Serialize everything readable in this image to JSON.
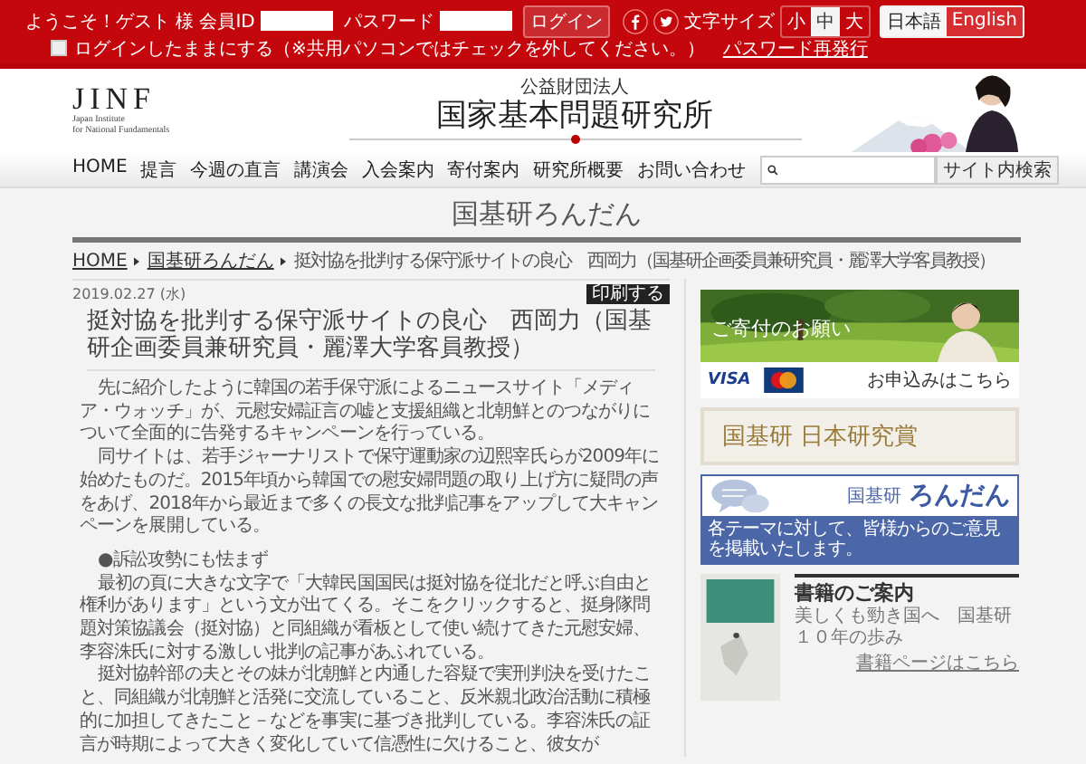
{
  "top_bar": {
    "welcome": "ようこそ！ゲスト 様",
    "member_id_label": "会員ID",
    "password_label": "パスワード",
    "login_button": "ログイン",
    "font_size_label": "文字サイズ",
    "font_sizes": [
      {
        "label": "小",
        "selected": false
      },
      {
        "label": "中",
        "selected": true
      },
      {
        "label": "大",
        "selected": false
      }
    ],
    "languages": [
      {
        "label": "日本語",
        "selected": true
      },
      {
        "label": "English",
        "selected": false
      }
    ],
    "remember": {
      "label": "ログインしたままにする（※共用パソコンではチェックを外してください。）",
      "checked": false
    },
    "reset_link": "パスワード再発行"
  },
  "header": {
    "logo": "JINF",
    "logo_subtitle_1": "Japan Institute",
    "logo_subtitle_2": "for National Fundamentals",
    "org_type": "公益財団法人",
    "org_name": "国家基本問題研究所"
  },
  "nav": {
    "items": [
      {
        "label": "HOME"
      },
      {
        "label": "提言"
      },
      {
        "label": "今週の直言"
      },
      {
        "label": "講演会"
      },
      {
        "label": "入会案内"
      },
      {
        "label": "寄付案内"
      },
      {
        "label": "研究所概要"
      },
      {
        "label": "お問い合わせ"
      }
    ],
    "search_button": "サイト内検索"
  },
  "page_title": "国基研ろんだん",
  "breadcrumb": [
    {
      "label": "HOME",
      "link": true
    },
    {
      "label": "国基研ろんだん",
      "link": true
    },
    {
      "label": "挺対協を批判する保守派サイトの良心　西岡力（国基研企画委員兼研究員・麗澤大学客員教授）",
      "link": false
    }
  ],
  "article": {
    "date": "2019.02.27 (水)",
    "print_button": "印刷する",
    "title": "挺対協を批判する保守派サイトの良心　西岡力（国基研企画委員兼研究員・麗澤大学客員教授）",
    "blocks": [
      {
        "kind": "paragraph",
        "text": "先に紹介したように韓国の若手保守派によるニュースサイト「メディア・ウォッチ」が、元慰安婦証言の嘘と支援組織と北朝鮮とのつながりについて全面的に告発するキャンペーンを行っている。"
      },
      {
        "kind": "paragraph",
        "text": "同サイトは、若手ジャーナリストで保守運動家の辺熙宰氏らが2009年に始めたものだ。2015年頃から韓国での慰安婦問題の取り上げ方に疑問の声をあげ、2018年から最近まで多くの長文な批判記事をアップして大キャンペーンを展開している。"
      },
      {
        "kind": "heading",
        "text": "●訴訟攻勢にも怯まず"
      },
      {
        "kind": "paragraph",
        "text": "最初の頁に大きな文字で「大韓民国国民は挺対協を従北だと呼ぶ自由と権利があります」という文が出てくる。そこをクリックすると、挺身隊問題対策協議会（挺対協）と同組織が看板として使い続けてきた元慰安婦、李容洙氏に対する激しい批判の記事があふれている。"
      },
      {
        "kind": "paragraph",
        "text": "挺対協幹部の夫とその妹が北朝鮮と内通した容疑で実刑判決を受けたこと、同組織が北朝鮮と活発に交流していること、反米親北政治活動に積極的に加担してきたこと－などを事実に基づき批判している。李容洙氏の証言が時期によって大きく変化していて信憑性に欠けること、彼女が"
      }
    ]
  },
  "sidebar": {
    "donation": {
      "banner_text": "ご寄付のお願い",
      "card_1": "VISA",
      "apply_link": "お申込みはこちら"
    },
    "award": {
      "text": "国基研 日本研究賞"
    },
    "rondan": {
      "prefix": "国基研",
      "title": "ろんだん",
      "strip": "各テーマに対して、皆様からのご意見を掲載いたします。"
    },
    "books": {
      "heading": "書籍のご案内",
      "title": "美しくも勁き国へ　国基研１０年の歩み",
      "link": "書籍ページはこちら"
    }
  }
}
